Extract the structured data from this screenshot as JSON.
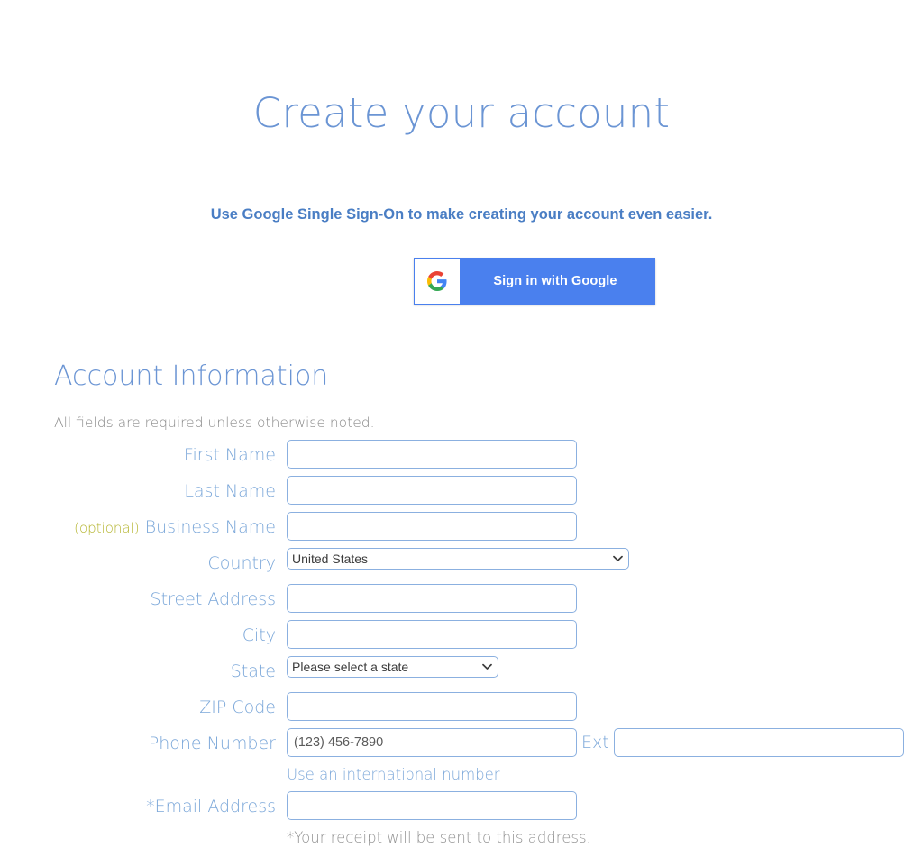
{
  "page": {
    "title": "Create your account"
  },
  "sso": {
    "subtitle": "Use Google Single Sign-On to make creating your account even easier.",
    "button_label": "Sign in with Google",
    "button_icon": "google-g-icon",
    "button_bg": "#4a80ee"
  },
  "section": {
    "heading": "Account Information",
    "note": "All fields are required unless otherwise noted."
  },
  "fields": {
    "first_name": {
      "label": "First Name",
      "value": "",
      "placeholder": ""
    },
    "last_name": {
      "label": "Last Name",
      "value": "",
      "placeholder": ""
    },
    "business_name": {
      "label": "Business Name",
      "optional_tag": "(optional)",
      "value": "",
      "placeholder": ""
    },
    "country": {
      "label": "Country",
      "value": "United States",
      "options": [
        "United States"
      ]
    },
    "street_address": {
      "label": "Street Address",
      "value": "",
      "placeholder": ""
    },
    "city": {
      "label": "City",
      "value": "",
      "placeholder": ""
    },
    "state": {
      "label": "State",
      "value": "Please select a state",
      "options": [
        "Please select a state"
      ]
    },
    "zip_code": {
      "label": "ZIP Code",
      "value": "",
      "placeholder": ""
    },
    "phone_number": {
      "label": "Phone Number",
      "value": "",
      "placeholder": "(123) 456-7890"
    },
    "ext": {
      "label": "Ext",
      "value": "",
      "placeholder": ""
    },
    "email_address": {
      "label": "*Email Address",
      "value": "",
      "placeholder": ""
    }
  },
  "notes": {
    "international_link": "Use an international number",
    "email_receipt": "*Your receipt will be sent to this address."
  },
  "colors": {
    "label_blue": "#7ba7d9",
    "heading_blue": "#6b95d4",
    "optional_olive": "#b5b530",
    "input_border": "#8bb0e0",
    "google_blue": "#4a80ee"
  }
}
